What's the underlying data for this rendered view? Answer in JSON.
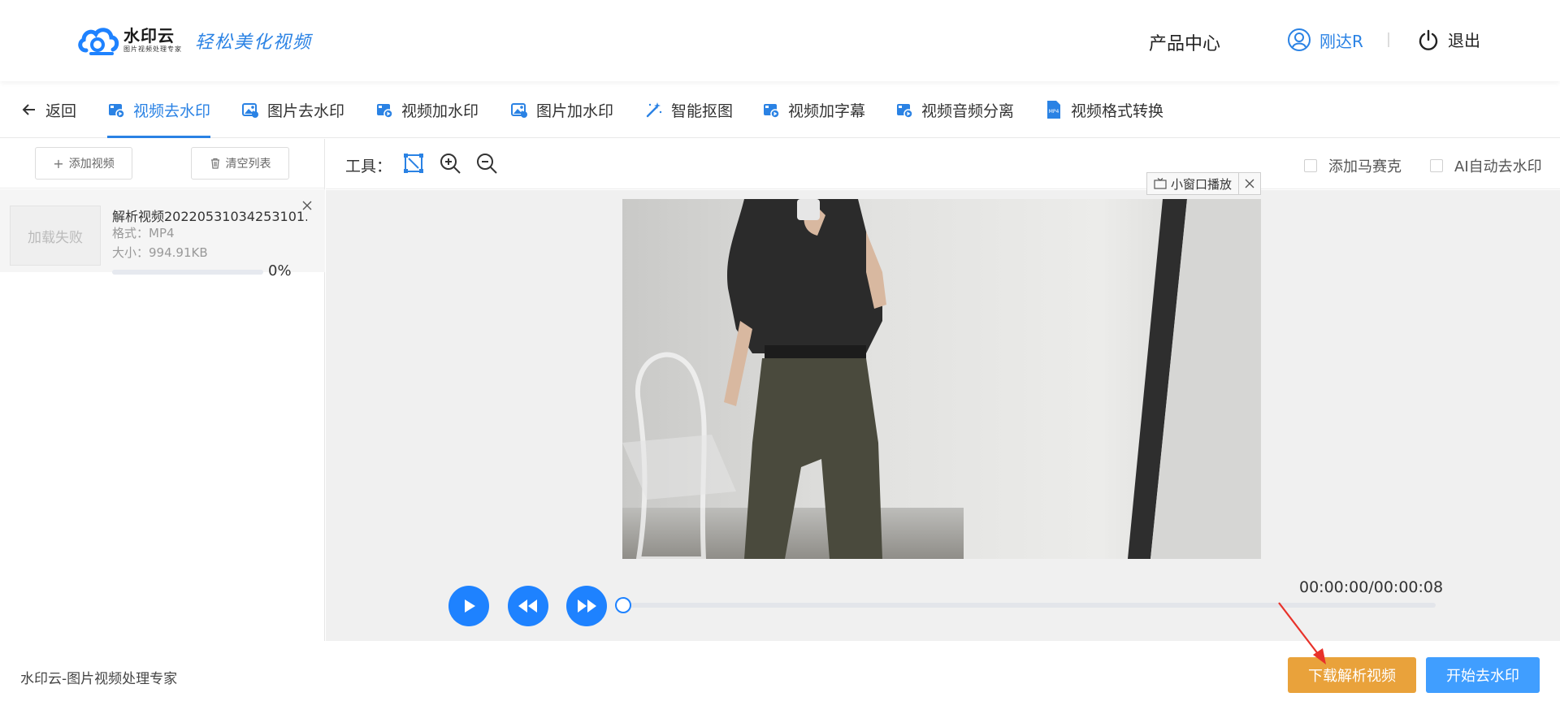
{
  "header": {
    "logo_name": "水印云",
    "logo_sub": "图片视频处理专家",
    "slogan": "轻松美化视频",
    "product_center": "产品中心",
    "user_name": "刚达R",
    "logout": "退出"
  },
  "tabs": {
    "back": "返回",
    "items": [
      {
        "label": "视频去水印",
        "icon": "video-icon"
      },
      {
        "label": "图片去水印",
        "icon": "image-icon"
      },
      {
        "label": "视频加水印",
        "icon": "video-icon"
      },
      {
        "label": "图片加水印",
        "icon": "image-icon"
      },
      {
        "label": "智能抠图",
        "icon": "magic-wand-icon"
      },
      {
        "label": "视频加字幕",
        "icon": "video-icon"
      },
      {
        "label": "视频音频分离",
        "icon": "video-icon"
      },
      {
        "label": "视频格式转换",
        "icon": "mp4-file-icon"
      }
    ],
    "active_index": 0
  },
  "left": {
    "add_video": "添加视频",
    "clear_list": "清空列表",
    "file": {
      "thumb_status": "加载失败",
      "name": "解析视频20220531034253101...",
      "format": "格式：MP4",
      "size": "大小：994.91KB",
      "progress_label": "0%",
      "progress": 0
    }
  },
  "toolbar": {
    "label": "工具：",
    "mosaic": "添加马赛克",
    "ai_remove": "AI自动去水印"
  },
  "stage": {
    "mini_window": "小窗口播放"
  },
  "player": {
    "time": "00:00:00/00:00:08",
    "progress": 0
  },
  "footer": {
    "text": "水印云-图片视频处理专家",
    "download": "下载解析视频",
    "start": "开始去水印"
  },
  "colors": {
    "accent": "#2a82e4",
    "play_blue": "#1e82ff",
    "download_btn": "#e9a23b",
    "start_btn": "#409eff",
    "arrow": "#e8322a"
  }
}
